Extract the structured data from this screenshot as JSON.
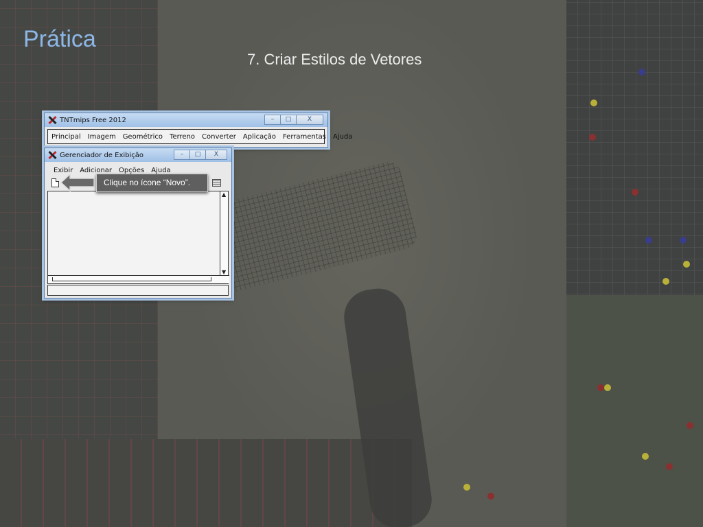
{
  "slide": {
    "title": "Prática",
    "subtitle": "7. Criar Estilos de Vetores"
  },
  "main_window": {
    "title": "TNTmips Free 2012",
    "controls": {
      "minimize": "–",
      "maximize": "□",
      "close": "X"
    },
    "menu": [
      "Principal",
      "Imagem",
      "Geométrico",
      "Terreno",
      "Converter",
      "Aplicação",
      "Ferramentas",
      "Ajuda"
    ]
  },
  "display_window": {
    "title": "Gerenciador de Exibição",
    "controls": {
      "minimize": "–",
      "maximize": "□",
      "close": "X"
    },
    "menu": [
      "Exibir",
      "Adicionar",
      "Opções",
      "Ajuda"
    ],
    "scroll": {
      "up": "▲",
      "down": "▼",
      "left": "◀",
      "right": "▶"
    }
  },
  "callout": {
    "text": "Clique no ícone “Novo”."
  },
  "colors": {
    "title_blue": "#8db7e6",
    "callout_bg": "#5f5f5f"
  }
}
